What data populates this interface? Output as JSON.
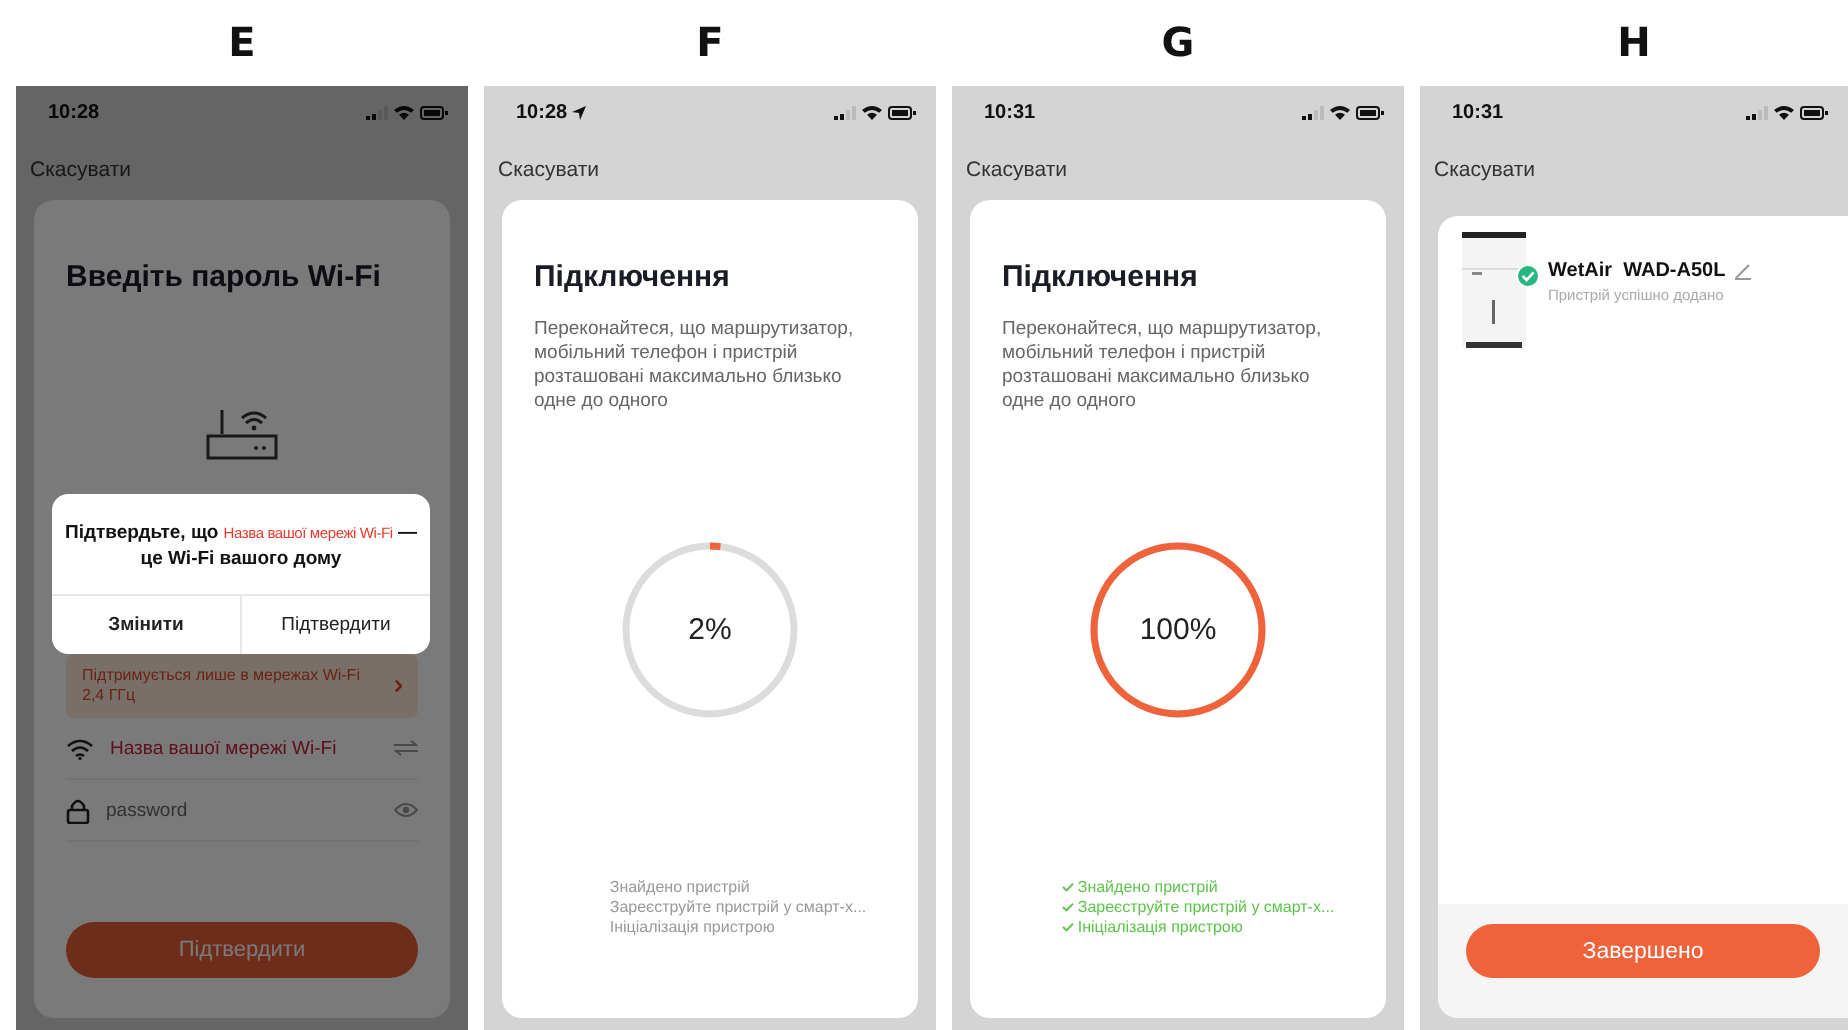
{
  "screens": [
    {
      "label": "E",
      "kind": "wifi_password",
      "status_bar": {
        "time": "10:28",
        "location": false
      },
      "cancel": "Скасувати",
      "dimmed": true,
      "title": "Введіть пароль Wi-Fi",
      "notice": "Підтримується лише в мережах Wi-Fi 2,4 ГГц",
      "network_field": {
        "value": "Назва вашої мережі Wi-Fi"
      },
      "password_field": {
        "placeholder": "password"
      },
      "submit_button": "Підтвердити",
      "dialog": {
        "message_start": "Підтвердьте, що",
        "network": "Назва вашої мережі Wi-Fi",
        "message_end": "— це Wi-Fi вашого дому",
        "buttons": [
          {
            "label": "Змінити",
            "emphasized": true
          },
          {
            "label": "Підтвердити",
            "emphasized": false
          }
        ]
      }
    },
    {
      "label": "F",
      "kind": "connecting",
      "status_bar": {
        "time": "10:28",
        "location": true
      },
      "cancel": "Скасувати",
      "title": "Підключення",
      "description": "Переконайтеся, що маршрутизатор, мобільний телефон і пристрій розташовані максимально близько одне до одного",
      "progress": {
        "level": 0.02,
        "reading": "2%"
      },
      "steps": [
        {
          "text": "Знайдено пристрій",
          "done": false
        },
        {
          "text": "Зареєструйте пристрій у смарт-х...",
          "done": false
        },
        {
          "text": "Ініціалізація пристрою",
          "done": false
        }
      ]
    },
    {
      "label": "G",
      "kind": "connecting",
      "status_bar": {
        "time": "10:31",
        "location": false
      },
      "cancel": "Скасувати",
      "title": "Підключення",
      "description": "Переконайтеся, що маршрутизатор, мобільний телефон і пристрій розташовані максимально близько одне до одного",
      "progress": {
        "level": 1,
        "reading": "100%"
      },
      "steps": [
        {
          "text": "Знайдено пристрій",
          "done": true
        },
        {
          "text": "Зареєструйте пристрій у смарт-х...",
          "done": true
        },
        {
          "text": "Ініціалізація пристрою",
          "done": true
        }
      ]
    },
    {
      "label": "H",
      "kind": "added",
      "status_bar": {
        "time": "10:31",
        "location": false
      },
      "cancel": "Скасувати",
      "device": {
        "kind": "picture",
        "name": "WetAir  WAD-A50L",
        "status": "Пристрій успішно додано"
      },
      "done_button": "Завершено"
    }
  ]
}
